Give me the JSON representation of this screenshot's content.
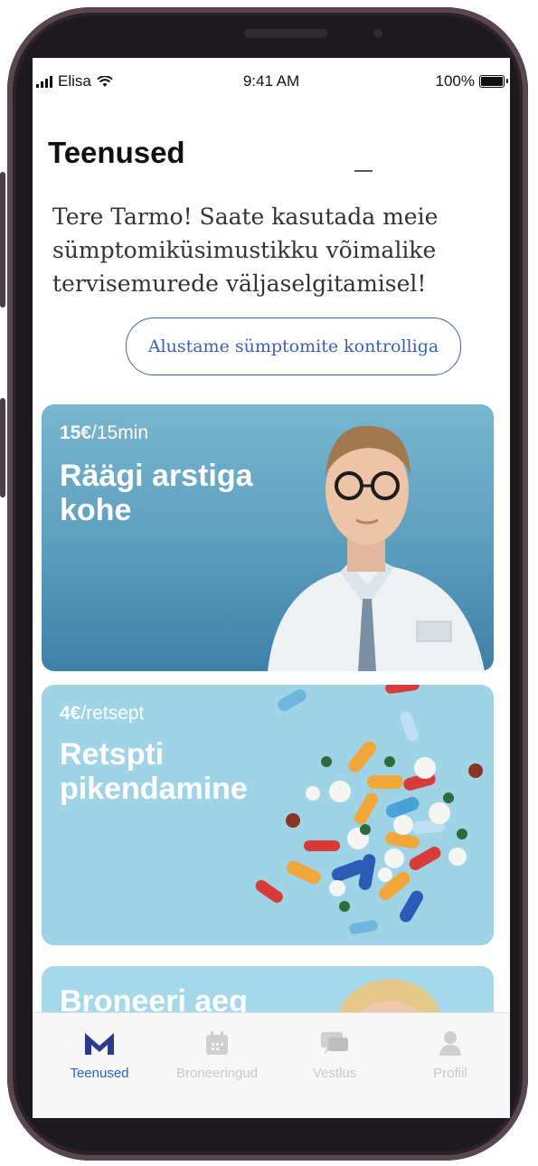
{
  "status_bar": {
    "carrier": "Elisa",
    "time": "9:41 AM",
    "battery": "100%"
  },
  "page": {
    "title": "Teenused",
    "intro": "Tere Tarmo! Saate kasutada meie sümptomiküsimustikku võimalike tervisemurede väljaselgitamisel!",
    "symptom_button": "Alustame sümptomite kontrolliga"
  },
  "cards": [
    {
      "price_bold": "15€",
      "price_rest": "/15min",
      "title_line1": "Räägi arstiga",
      "title_line2": "kohe"
    },
    {
      "price_bold": "4€",
      "price_rest": "/retsept",
      "title_line1": "Retspti",
      "title_line2": "pikendamine"
    },
    {
      "title_line1": "Broneeri aeg"
    }
  ],
  "tabbar": {
    "items": [
      {
        "label": "Teenused",
        "icon": "m-logo-icon",
        "active": true
      },
      {
        "label": "Broneeringud",
        "icon": "calendar-icon",
        "active": false
      },
      {
        "label": "Vestlus",
        "icon": "chat-icon",
        "active": false
      },
      {
        "label": "Profiil",
        "icon": "person-icon",
        "active": false
      }
    ]
  },
  "colors": {
    "accent": "#2563c9",
    "pill_border": "#3a62b4",
    "doctor_card": "#5c9dbd",
    "pills_card": "#9fd3e6"
  }
}
